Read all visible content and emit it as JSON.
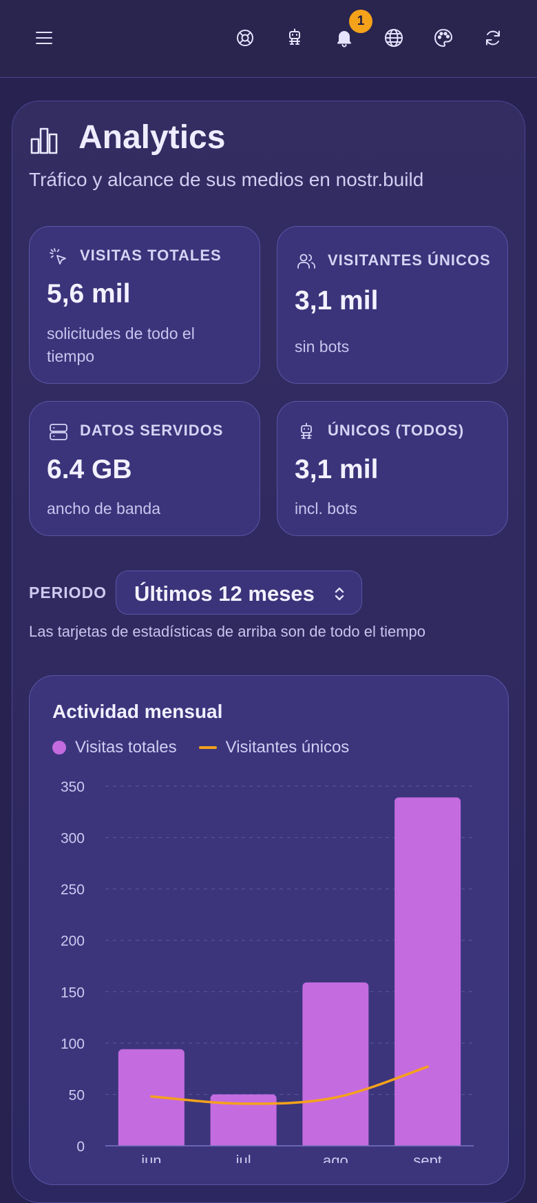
{
  "topbar": {
    "notification_count": "1",
    "icons": [
      "menu-icon",
      "lifebuoy-icon",
      "robot-icon",
      "bell-icon",
      "globe-icon",
      "palette-icon",
      "refresh-icon"
    ]
  },
  "header": {
    "title": "Analytics",
    "subtitle": "Tráfico y alcance de sus medios en nostr.build"
  },
  "stats": [
    {
      "label": "VISITAS TOTALES",
      "value": "5,6 mil",
      "desc": "solicitudes de todo el tiempo",
      "icon": "pointer-click-icon"
    },
    {
      "label": "VISITANTES ÚNICOS",
      "value": "3,1 mil",
      "desc": "sin bots",
      "icon": "users-icon"
    },
    {
      "label": "DATOS SERVIDOS",
      "value": "6.4 GB",
      "desc": "ancho de banda",
      "icon": "server-icon"
    },
    {
      "label": "ÚNICOS (TODOS)",
      "value": "3,1 mil",
      "desc": "incl. bots",
      "icon": "robot-icon"
    }
  ],
  "period": {
    "label": "PERIODO",
    "selected": "Últimos 12 meses",
    "note": "Las tarjetas de estadísticas de arriba son de todo el tiempo"
  },
  "colors": {
    "bar": "#c56be0",
    "line": "#f5a21b",
    "badge": "#f5a21b"
  },
  "chart_data": {
    "type": "bar",
    "title": "Actividad mensual",
    "categories": [
      "jun",
      "jul",
      "ago",
      "sept"
    ],
    "series": [
      {
        "name": "Visitas totales",
        "type": "bar",
        "values": [
          94,
          50,
          159,
          339
        ]
      },
      {
        "name": "Visitantes únicos",
        "type": "line",
        "values": [
          48,
          41,
          47,
          77
        ]
      }
    ],
    "yticks": [
      0,
      50,
      100,
      150,
      200,
      250,
      300,
      350
    ],
    "ylim": [
      0,
      350
    ],
    "grid": true,
    "legend": "top-left"
  }
}
